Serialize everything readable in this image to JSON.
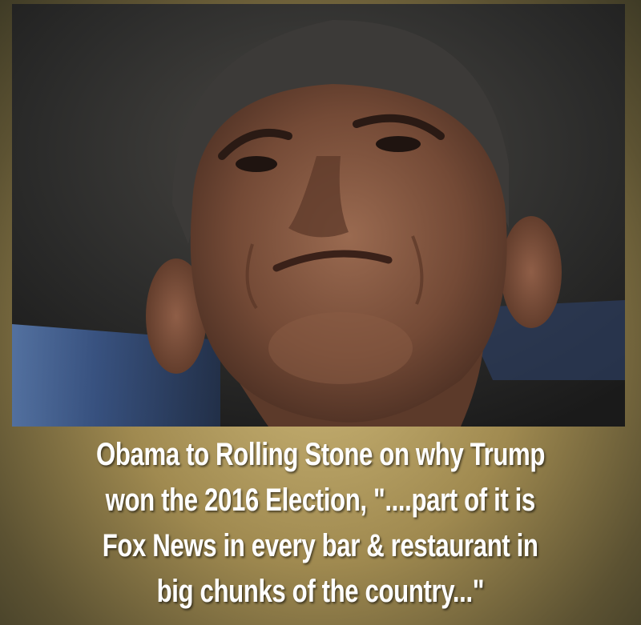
{
  "photo": {
    "subject": "portrait-photo"
  },
  "caption": {
    "lines": [
      "Obama to Rolling Stone on why Trump",
      "won the 2016 Election, \"....part of it is",
      "Fox News in every bar & restaurant in",
      "big chunks of the country...\""
    ]
  },
  "colors": {
    "background": "#a08a50",
    "caption_text": "#ffffff"
  }
}
